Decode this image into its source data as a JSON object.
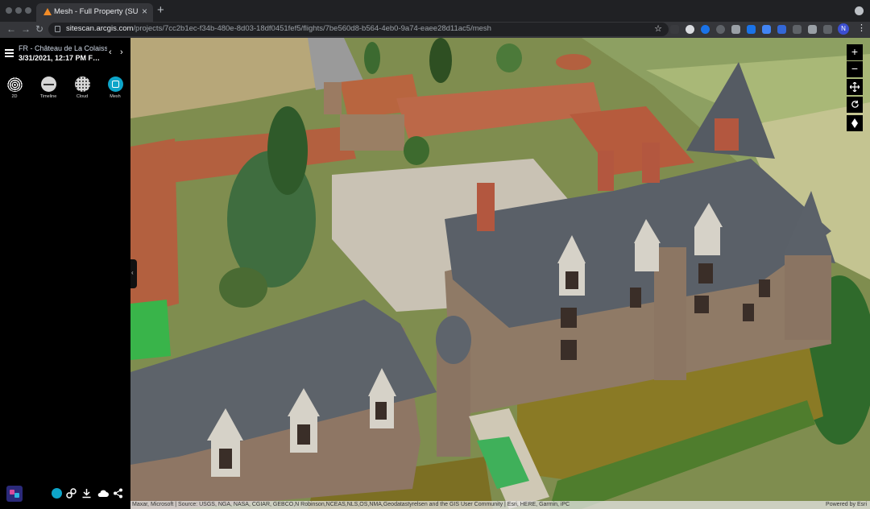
{
  "browser": {
    "tab_title": "Mesh - Full Property (SURE Hi",
    "tab_close": "×",
    "new_tab": "+",
    "url_host": "sitescan.arcgis.com",
    "url_path": "/projects/7cc2b1ec-f34b-480e-8d03-18df0451fef5/flights/7be560d8-b564-4eb0-9a74-eaee28d11ac5/mesh",
    "profile_initial": "N",
    "back": "←",
    "forward": "→",
    "reload": "↻",
    "star": "☆"
  },
  "sidebar": {
    "project_name": "FR - Château de La Colaiss…",
    "flight_label": "3/31/2021, 12:17 PM  F…",
    "prev": "‹",
    "next": "›",
    "tools": [
      {
        "label": "2D",
        "icon": "fingerprint-icon"
      },
      {
        "label": "Timeline",
        "icon": "timeline-icon"
      },
      {
        "label": "Cloud",
        "icon": "point-cloud-icon"
      },
      {
        "label": "Mesh",
        "icon": "mesh-icon"
      }
    ],
    "collapse": "‹"
  },
  "map": {
    "zoom_in": "+",
    "zoom_out": "−",
    "attribution": "Maxar, Microsoft | Source: USGS, NGA, NASA, CGIAR, GEBCO,N Robinson,NCEAS,NLS,OS,NMA,Geodatastyrelsen and the GIS User Community | Esri, HERE, Garmin, iPC",
    "powered_by": "Powered by Esri"
  },
  "colors": {
    "accent_teal": "#0ea5c9",
    "roof_slate": "#5d636a",
    "roof_tile": "#b3603f",
    "moat_water": "#8a7a25"
  }
}
